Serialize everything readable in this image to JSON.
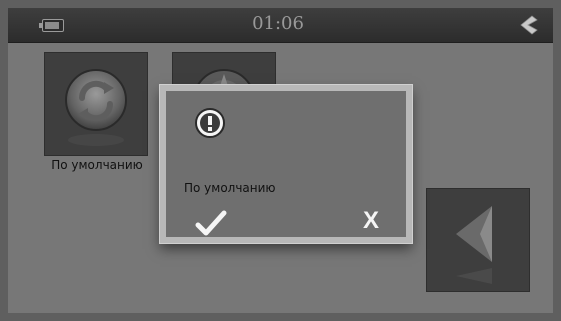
{
  "statusbar": {
    "time": "01:06",
    "battery_icon": "battery-icon",
    "back_icon": "chevron-left-icon"
  },
  "tiles": [
    {
      "icon": "refresh-icon",
      "label": "По умолчанию"
    },
    {
      "icon": "compass-icon",
      "label": ""
    },
    {
      "icon": "triangle-left-icon",
      "label": ""
    }
  ],
  "dialog": {
    "icon": "warning-icon",
    "message": "По умолчанию",
    "confirm_icon": "checkmark-icon",
    "cancel_label": "X"
  },
  "colors": {
    "background": "#777777",
    "topbar": "#2c2c2c",
    "dialog_border": "#b8b8b8"
  }
}
